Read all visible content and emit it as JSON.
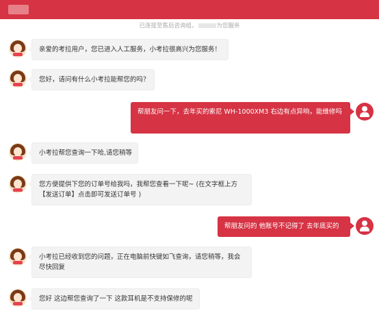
{
  "colors": {
    "brand": "#d63344",
    "bot_bubble": "#f3f3f3"
  },
  "notice": {
    "prefix": "已连接至售后咨询组，",
    "suffix": "为您服务"
  },
  "messages": [
    {
      "sender": "bot",
      "text": "亲爱的考拉用户，您已进入人工服务，小考拉很高兴为您服务！"
    },
    {
      "sender": "bot",
      "text": "您好，请问有什么小考拉能帮您的吗？"
    },
    {
      "sender": "user",
      "text": "帮朋友问一下，去年买的索尼 WH-1000XM3 右边有点异响，能维修吗"
    },
    {
      "sender": "bot",
      "text": "小考拉帮您查询一下哈,请您稍等"
    },
    {
      "sender": "bot",
      "text": "您方便提供下您的订单号给我吗，我帮您查看一下呢~ (在文字框上方【发送订单】点击即可发送订单号 )"
    },
    {
      "sender": "user",
      "text": "帮朋友问的  他账号不记得了  去年底买的"
    },
    {
      "sender": "bot",
      "text": "小考拉已经收到您的问题，正在电脑前快键如飞查询，请您稍等，我会尽快回复"
    },
    {
      "sender": "bot",
      "text": "您好 这边帮您查询了一下 这款耳机是不支持保修的呢"
    }
  ]
}
